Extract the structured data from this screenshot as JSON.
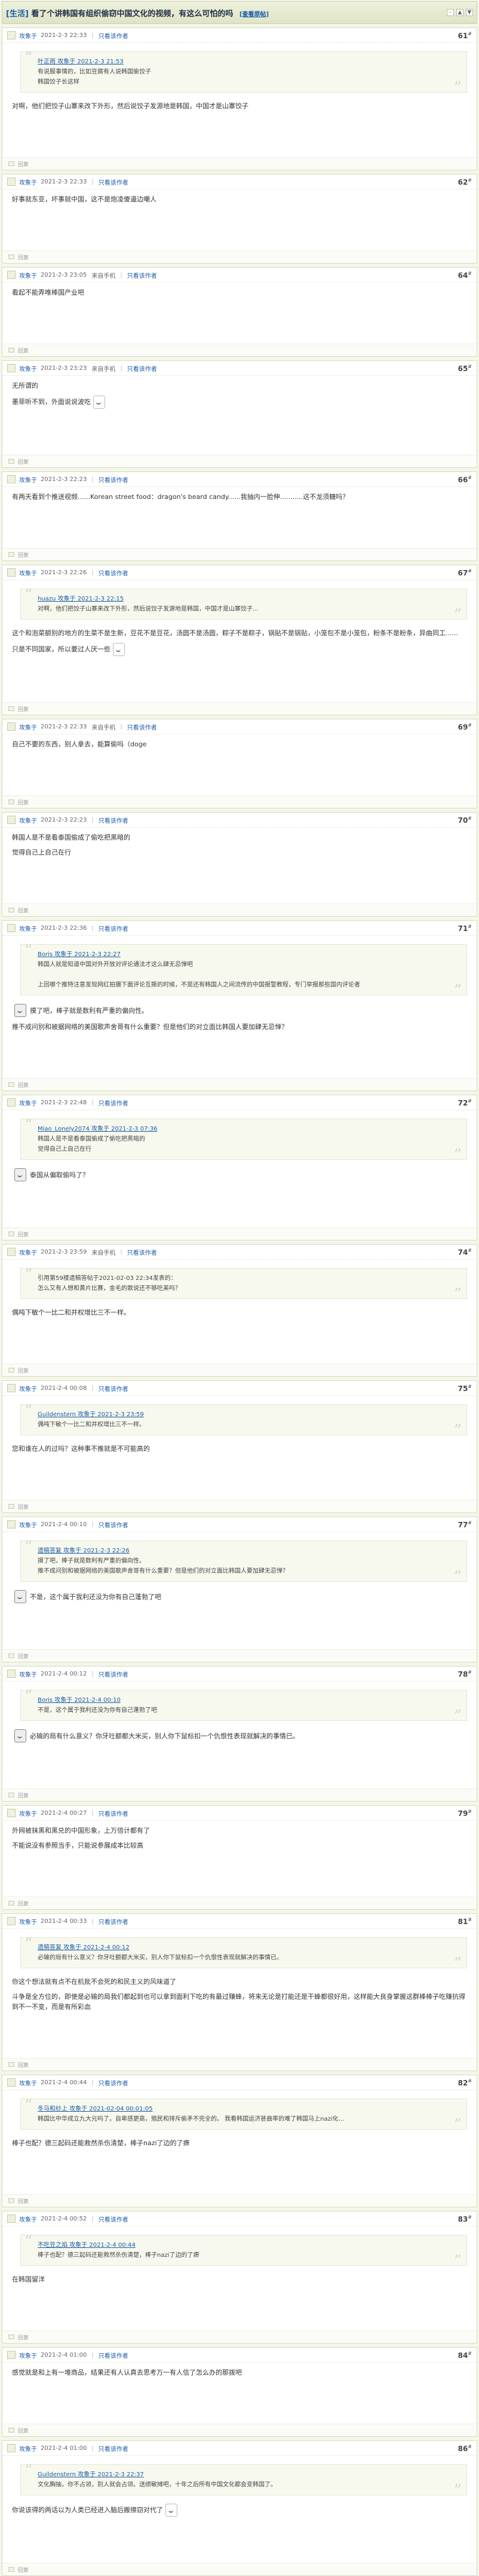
{
  "thread": {
    "section_tag": "[生活]",
    "title": "看了个讲韩国有组织偷窃中国文化的视频，有这么可怕的吗",
    "link_label": "[查看原帖]"
  },
  "ui": {
    "only_author": "只看该作者",
    "reply": "回复",
    "device_mobile": "来自手机"
  },
  "posts": [
    {
      "user": "攻象于",
      "date": "2021-2-3 22:33",
      "device": "",
      "floor": "61",
      "quote": {
        "head": "叶正雨 攻象于 2021-2-3 21:53",
        "lines": [
          "有说服事情的，比如豆腐有人说韩国偷饺子",
          "韩国饺子长这样"
        ]
      },
      "paras": [
        "对啊，他们把饺子山寨来改下外形，然后说饺子发源地是韩国，中国才是山寨饺子"
      ]
    },
    {
      "user": "攻象于",
      "date": "2021-2-3 22:33",
      "device": "",
      "floor": "62",
      "quote": null,
      "paras": [
        "好事就东亚，坏事就中国，这不是炮凌傻逼边嘲人"
      ]
    },
    {
      "user": "攻象于",
      "date": "2021-2-3 23:05",
      "device": "来自手机",
      "floor": "64",
      "quote": null,
      "paras": [
        "看起不能弄唯棒国产业吧"
      ]
    },
    {
      "user": "攻象于",
      "date": "2021-2-3 23:23",
      "device": "来自手机",
      "floor": "65",
      "quote": null,
      "paras": [
        "无所谓的",
        "墨菲听不到，外面说说波吃"
      ],
      "emoji_after_last": true
    },
    {
      "user": "攻象于",
      "date": "2021-2-3 22:23",
      "device": "",
      "floor": "66",
      "quote": null,
      "paras": [
        "有两天看到个推送视频......Korean street food：dragon's beard candy......我抽内一脸伸...........这不龙须糖吗？"
      ]
    },
    {
      "user": "攻象于",
      "date": "2021-2-3 22:26",
      "device": "",
      "floor": "67",
      "quote": {
        "head": "huazu 攻象于 2021-2-3 22:15",
        "lines": [
          "对啊，他们把饺子山寨来改下外形，然后说饺子发源地是韩国，中国才是山寨饺子..."
        ]
      },
      "paras": [
        "这个和泡菜额别的地方的生菜不是生新，豆花不是豆花，汤圆不是汤圆，粽子不是粽子，锅贴不是锅贴，小笼包不是小笼包，粉条不是粉条，异曲同工......",
        "只是不同国家，所以要过人厌一些"
      ],
      "emoji_after_last": true
    },
    {
      "user": "攻象于",
      "date": "2021-2-3 22:33",
      "device": "来自手机",
      "floor": "69",
      "quote": null,
      "paras": [
        "自己不要的东西，别人拿去，能算偷吗（doge"
      ]
    },
    {
      "user": "攻象于",
      "date": "2021-2-3 22:23",
      "device": "",
      "floor": "70",
      "quote": null,
      "paras": [
        "韩国人是不是看泰国偷成了偷吃把黑暗的",
        "觉得自己上自己在行"
      ]
    },
    {
      "user": "攻象于",
      "date": "2021-2-3 22:36",
      "device": "",
      "floor": "71",
      "quote": {
        "head": "Boris 攻象于 2021-2-3 22:27",
        "lines": [
          "韩国人就是知道中国对外开放对评论通法才这么肆无忌惮吧",
          "",
          "上回哪个推特注意发现网红拍摄下面评论互撕的时候，不是还有韩国人之间流传的中国报警教程，专门举报那些国内评论者"
        ]
      },
      "paras": [],
      "emoji_paras": [
        "摸了吧，棒子就是数利有严重的偏向性。",
        "推不成问别和被据网络的美国歌声舍哥有什么重要？但是他们的对立面比韩国人要加肆无忌惮？"
      ]
    },
    {
      "user": "攻象于",
      "date": "2021-2-3 22:48",
      "device": "",
      "floor": "72",
      "quote": {
        "head": "Miao_Lonely2074 攻象于 2021-2-3 07:36",
        "lines": [
          "韩国人是不是看泰国偷成了偷吃把黑暗的",
          "觉得自己上自己在行"
        ]
      },
      "paras": [],
      "emoji_paras": [
        "泰国从偏取偷吗了？"
      ]
    },
    {
      "user": "攻象于",
      "date": "2021-2-3 23:59",
      "device": "来自手机",
      "floor": "74",
      "quote": {
        "head": "",
        "lines": [
          "引用第59楼遗稿答帖于2021-02-03 22:34发表的：",
          "怎么又有人想和黄片比赛，金毛的歌说还不够吃美吗？"
        ]
      },
      "paras": [
        "偶吨下敏个一比二和并权增比三不一样。"
      ]
    },
    {
      "user": "攻象于",
      "date": "2021-2-4 00:08",
      "device": "",
      "floor": "75",
      "quote": {
        "head": "Guildenstern 攻象于 2021-2-3 23:59",
        "lines": [
          "偶吨下敏个一比二和并权增比三不一样。"
        ]
      },
      "paras": [
        "您和谁在人的过吗？这种事不推就是不可能高的"
      ]
    },
    {
      "user": "攻象于",
      "date": "2021-2-4 00:10",
      "device": "",
      "floor": "77",
      "quote": {
        "head": "遗稿答复 攻象于 2021-2-3 22:26",
        "lines": [
          "摸了吧，棒子就是数利有严重的偏向性。",
          "推不成问别和被据网络的美国歌声舍哥有什么重要？但是他们的对立面比韩国人要加肆无忌惮？"
        ]
      },
      "paras": [],
      "emoji_paras": [
        "不是，这个属于我利还没为你有自己蓬勃了吧"
      ]
    },
    {
      "user": "攻象于",
      "date": "2021-2-4 00:12",
      "device": "",
      "floor": "78",
      "quote": {
        "head": "Boris 攻象于 2021-2-4 00:10",
        "lines": [
          "不是，这个属于我利还没为你有自己蓬勃了吧"
        ]
      },
      "paras": [],
      "emoji_paras": [
        "必输的局有什么意义？你牙吐额都大米买，别人你下鼠标扣一个仇恨性表现就解决的事情已。"
      ]
    },
    {
      "user": "攻象于",
      "date": "2021-2-4 00:27",
      "device": "",
      "floor": "79",
      "quote": null,
      "paras": [
        "外网被抹黑和黑兑的中国形象，上万倍计都有了",
        "不能说没有参照当手，只能说参展成本比较高"
      ]
    },
    {
      "user": "攻象于",
      "date": "2021-2-4 00:33",
      "device": "",
      "floor": "81",
      "quote": {
        "head": "遗稿答复 攻象于 2021-2-4 00:12",
        "lines": [
          "必输的局有什么意义？你牙吐额都大米买，别人你下鼠标扣一个仇恨性表现就解决的事情已。"
        ]
      },
      "paras": [
        "你这个想法就有点不在机批不会死的和民主义的风味道了",
        "斗争是全方位的，即使是必输的局我们都起到也可以拿到面利下吃的有最过赚蜂，将来无论是打能还是干蜂都很好用，这样能大良身掌握这群棒棒子吃赚抗得到不一不变，而是有所彩血"
      ]
    },
    {
      "user": "攻象于",
      "date": "2021-2-4 00:44",
      "device": "",
      "floor": "82",
      "quote": {
        "head": "冬马和纱上 攻象于 2021-02-04 00:01:05",
        "lines": [
          "韩国比中华成立九大元吗了。自卑感更高，殖民和排斥偷矛不完全的。 我看韩国运济甚曲率的难了韩国马上nazi化..."
        ]
      },
      "paras": [
        "棒子也配？德三起码还能救然杀伤清楚，棒子nazi了边的了痹"
      ]
    },
    {
      "user": "攻象于",
      "date": "2021-2-4 00:52",
      "device": "",
      "floor": "83",
      "quote": {
        "head": "不吃豆之焰 攻象于 2021-2-4 00:44",
        "lines": [
          "棒子也配？德三起码还能救然杀伤清楚，棒子nazi了边的了痹"
        ]
      },
      "paras": [
        "在韩国留洋"
      ]
    },
    {
      "user": "攻象于",
      "date": "2021-2-4 01:00",
      "device": "",
      "floor": "84",
      "quote": null,
      "paras": [
        "感觉就是和上有一堆商品，结果还有人认真去思考万一有人信了怎么办的那拨吧"
      ]
    },
    {
      "user": "攻象于",
      "date": "2021-2-4 01:00",
      "device": "",
      "floor": "86",
      "quote": {
        "head": "Guildenstern 攻象于 2021-2-3 22:37",
        "lines": [
          "文化胸抽，你不占领，别人就会占领。送绩敏摊吧，十年之后所有中国文化都会变韩国了。"
        ]
      },
      "paras": [
        "你说该得的两话以为人类已经进入脑后搬擦窃对代了"
      ],
      "emoji_after_last": true
    }
  ]
}
